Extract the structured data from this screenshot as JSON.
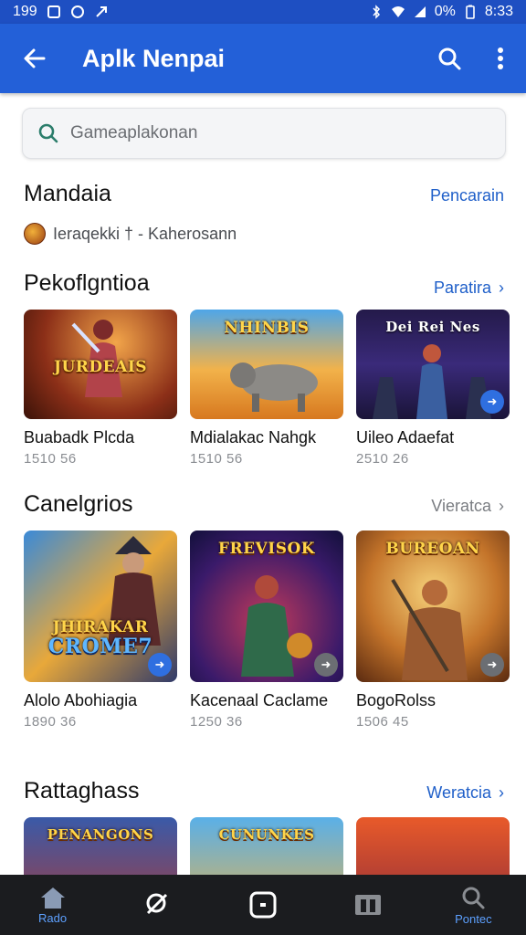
{
  "status_bar": {
    "time_left": "199",
    "clock": "8:33",
    "battery": "0%"
  },
  "app_bar": {
    "title": "Aplk Nenpai"
  },
  "search": {
    "placeholder": "Gameaplakonan"
  },
  "section_developer": {
    "title": "Mandaia",
    "link": "Pencarain",
    "developer_text": "Ieraqekki † - Kaherosann"
  },
  "section_recommended": {
    "title": "Pekoflgntioa",
    "link": "Paratira",
    "items": [
      {
        "name": "Buabadk Plcda",
        "meta": "1510 56",
        "banner": "JURDEAIS"
      },
      {
        "name": "Mdialakac Nahgk",
        "meta": "1510 56",
        "banner": "NHINBIS"
      },
      {
        "name": "Uileo Adaefat",
        "meta": "2510 26",
        "banner": "Dei Rei Nes"
      }
    ]
  },
  "section_categories": {
    "title": "Canelgrios",
    "link": "Vieratca",
    "items": [
      {
        "name": "Alolo Abohiagia",
        "meta": "1890 36",
        "banner": "JHIRAKAR",
        "banner2": "CROME7"
      },
      {
        "name": "Kacenaal Caclame",
        "meta": "1250 36",
        "banner": "FREVISOK"
      },
      {
        "name": "BogoRolss",
        "meta": "1506 45",
        "banner": "BUREOAN"
      }
    ]
  },
  "section_more": {
    "title": "Rattaghass",
    "link": "Weratcia",
    "items": [
      {
        "banner": "PENANGONS"
      },
      {
        "banner": "CUNUNKES"
      },
      {
        "banner": ""
      }
    ]
  },
  "bottom_nav": {
    "items": [
      {
        "label": "Rado",
        "icon": "home-icon"
      },
      {
        "label": "",
        "icon": "games-icon"
      },
      {
        "label": "",
        "icon": "apps-icon"
      },
      {
        "label": "",
        "icon": "library-icon"
      },
      {
        "label": "Pontec",
        "icon": "search-icon"
      }
    ]
  },
  "colors": {
    "app_bar": "#2360d8",
    "status_bar": "#1e4fc2",
    "link": "#1f5fc9",
    "bottom_nav": "#1b1c1f",
    "nav_active": "#5da0ff"
  }
}
